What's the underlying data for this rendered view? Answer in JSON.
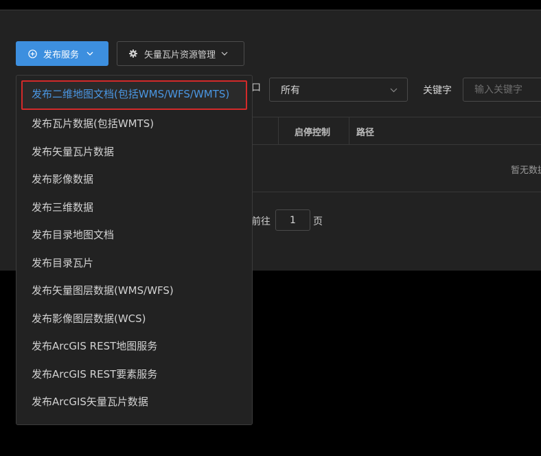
{
  "toolbar": {
    "publish_label": "发布服务",
    "vector_tile_mgmt_label": "矢量瓦片资源管理"
  },
  "filters": {
    "type_label_fragment": "口",
    "type_selected": "所有",
    "keyword_label": "关键字",
    "keyword_placeholder": "输入关键字"
  },
  "table": {
    "columns": [
      "启停控制",
      "路径"
    ],
    "empty_text": "暂无数据"
  },
  "pagination": {
    "goto_label": "前往",
    "page_value": "1",
    "page_suffix": "页"
  },
  "dropdown": {
    "items": [
      "发布二维地图文档(包括WMS/WFS/WMTS)",
      "发布瓦片数据(包括WMTS)",
      "发布矢量瓦片数据",
      "发布影像数据",
      "发布三维数据",
      "发布目录地图文档",
      "发布目录瓦片",
      "发布矢量图层数据(WMS/WFS)",
      "发布影像图层数据(WCS)",
      "发布ArcGIS REST地图服务",
      "发布ArcGIS REST要素服务",
      "发布ArcGIS矢量瓦片数据"
    ]
  },
  "colors": {
    "accent": "#3d8fdf",
    "highlight_border": "#d42a2a",
    "panel_bg": "#222222",
    "page_bg": "#000000"
  },
  "icons": {
    "publish": "plus-circle-icon",
    "settings": "gear-icon",
    "dropdown": "chevron-down-icon"
  }
}
